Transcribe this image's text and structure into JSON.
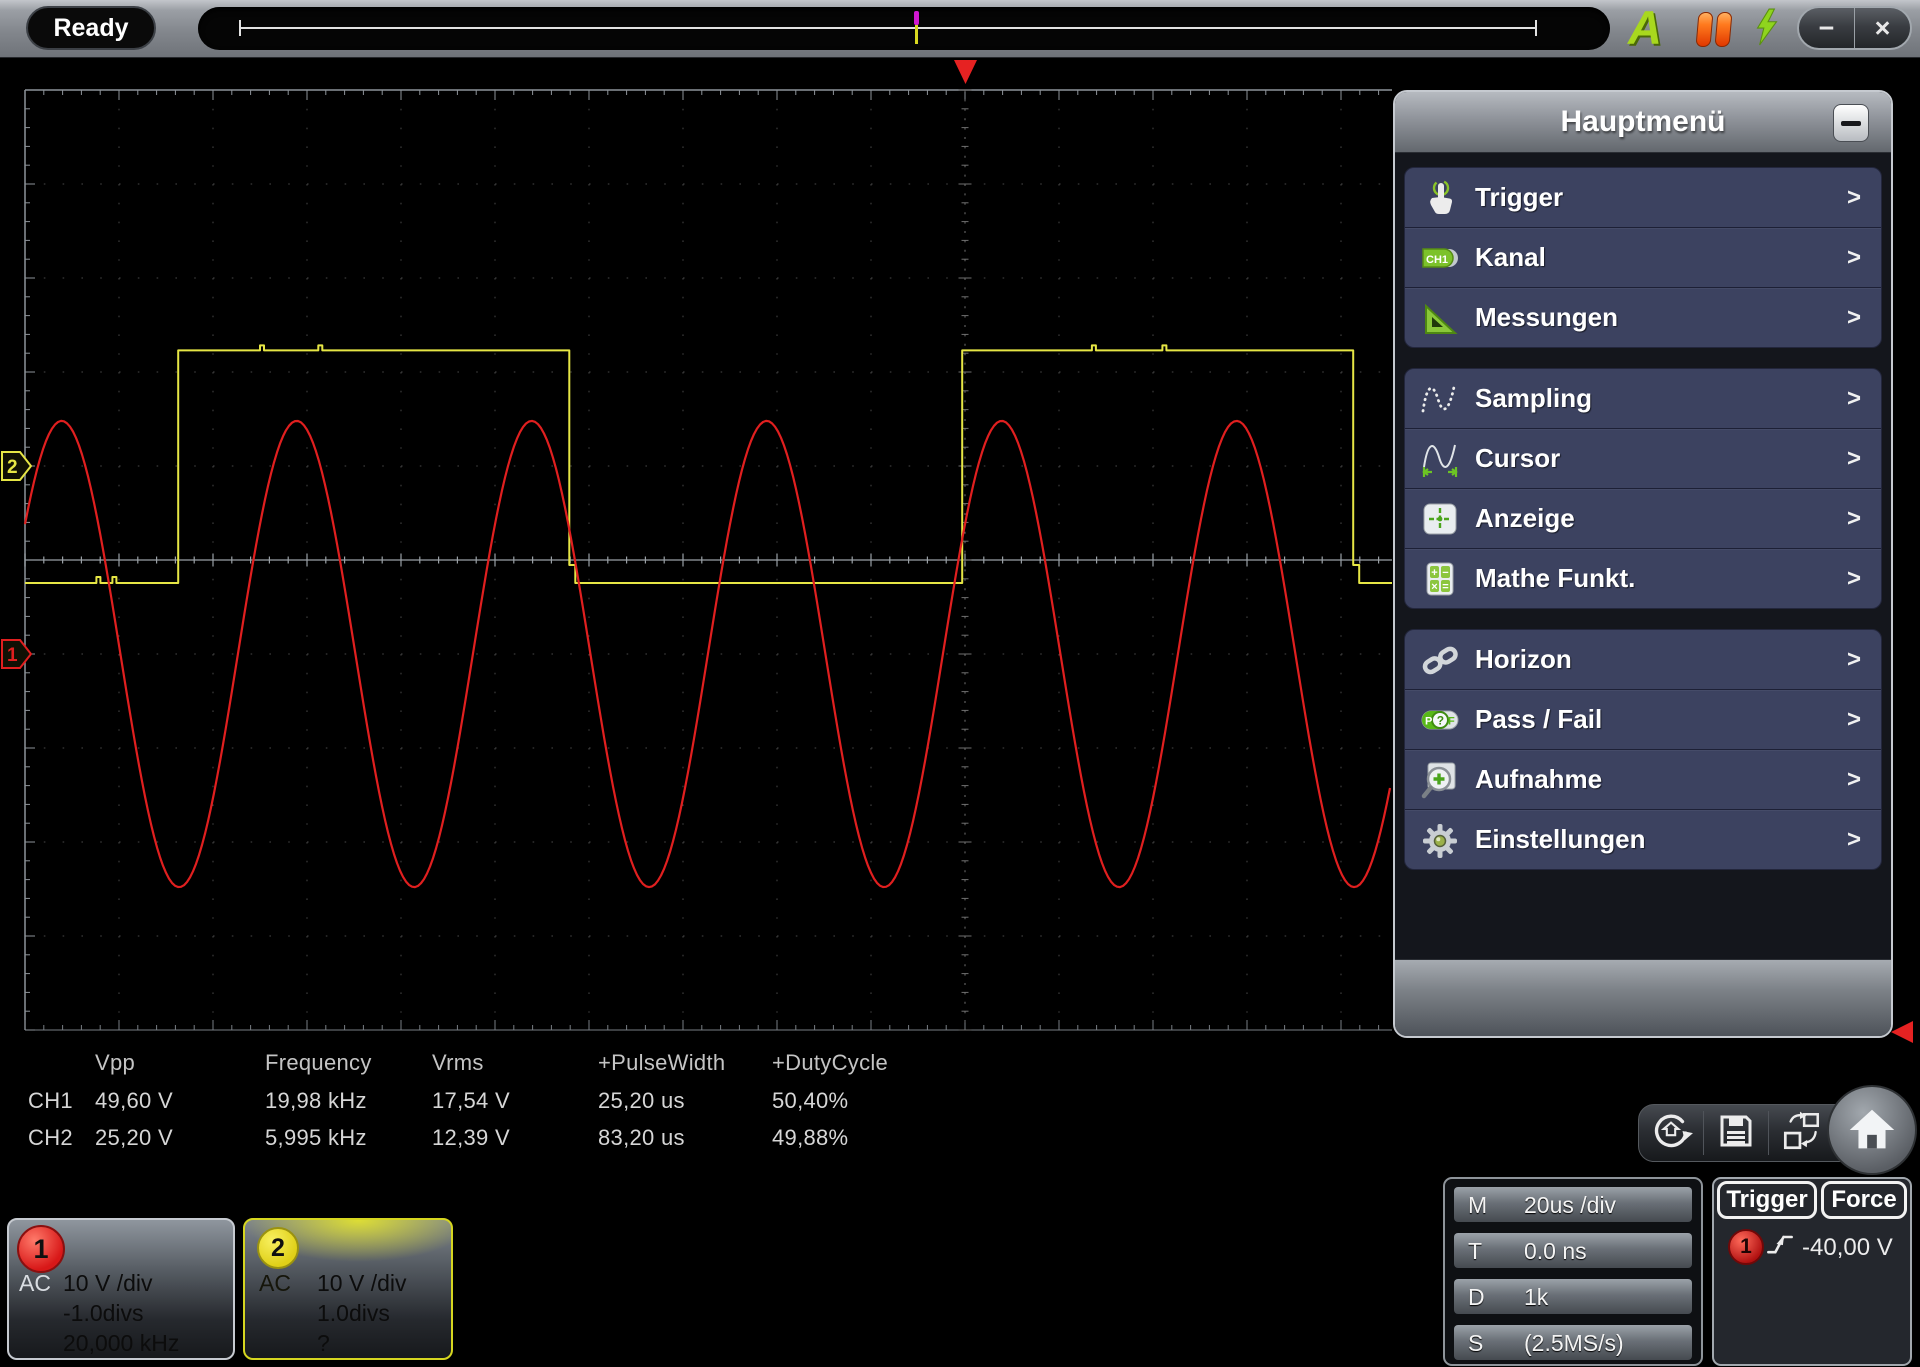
{
  "titlebar": {
    "status": "Ready",
    "auto_label": "A",
    "minimize_label": "−",
    "close_label": "×"
  },
  "menu": {
    "title": "Hauptmenü",
    "minimize_glyph": "−",
    "chevron": ">",
    "groups": [
      {
        "items": [
          {
            "label": "Trigger",
            "icon": "trigger-hand-icon"
          },
          {
            "label": "Kanal",
            "icon": "channel-tag-icon"
          },
          {
            "label": "Messungen",
            "icon": "measure-triangle-icon"
          }
        ]
      },
      {
        "items": [
          {
            "label": "Sampling",
            "icon": "sampling-sine-icon"
          },
          {
            "label": "Cursor",
            "icon": "cursor-sine-icon"
          },
          {
            "label": "Anzeige",
            "icon": "display-crosshair-icon"
          },
          {
            "label": "Mathe Funkt.",
            "icon": "math-calculator-icon"
          }
        ]
      },
      {
        "items": [
          {
            "label": "Horizon",
            "icon": "chain-link-icon"
          },
          {
            "label": "Pass / Fail",
            "icon": "pass-fail-icon"
          },
          {
            "label": "Aufnahme",
            "icon": "record-magnifier-icon"
          },
          {
            "label": "Einstellungen",
            "icon": "gear-icon"
          }
        ]
      }
    ]
  },
  "measurements": {
    "headers": [
      "Vpp",
      "Frequency",
      "Vrms",
      "+PulseWidth",
      "+DutyCycle"
    ],
    "rows": [
      {
        "channel": "CH1",
        "values": [
          "49,60 V",
          "19,98 kHz",
          "17,54 V",
          "25,20 us",
          "50,40%"
        ]
      },
      {
        "channel": "CH2",
        "values": [
          "25,20 V",
          "5,995 kHz",
          "12,39 V",
          "83,20 us",
          "49,88%"
        ]
      }
    ]
  },
  "channel_boxes": [
    {
      "number": "1",
      "coupling": "AC",
      "scale": "10 V /div",
      "position": "-1.0divs",
      "frequency": "20,000 kHz",
      "accent": "#d81818"
    },
    {
      "number": "2",
      "coupling": "AC",
      "scale": "10 V /div",
      "position": "1.0divs",
      "frequency": "?",
      "accent": "#e0d018"
    }
  ],
  "horizontal_panel": {
    "rows": [
      {
        "label": "M",
        "value": "20us /div"
      },
      {
        "label": "T",
        "value": "0.0 ns"
      },
      {
        "label": "D",
        "value": "1k"
      },
      {
        "label": "S",
        "value": "(2.5MS/s)"
      }
    ]
  },
  "trigger_panel": {
    "trigger_button": "Trigger",
    "force_button": "Force",
    "source_channel": "1",
    "level": "-40,00 V"
  },
  "toolbar_icons": [
    "reset-default-icon",
    "save-icon",
    "swap-window-icon"
  ],
  "chart_data": {
    "type": "line",
    "title": "Oscilloscope display: CH1 sine, CH2 square",
    "x_axis": {
      "divs": 20,
      "time_per_div": "20us",
      "trigger_position_div": 10
    },
    "y_axis": {
      "divs": 10
    },
    "series": [
      {
        "name": "CH1",
        "shape": "sine",
        "color": "#e01f1f",
        "volts_per_div": "10 V",
        "amplitude_div": 2.48,
        "center_offset_div": -1.0,
        "period_div": 2.5,
        "first_peak_div": 2.89,
        "frequency": "19,98 kHz",
        "marker": "1",
        "marker_position_div": -1.0
      },
      {
        "name": "CH2",
        "shape": "square",
        "color": "#e6e645",
        "volts_per_div": "10 V",
        "high_level_div": 2.23,
        "low_level_div": -0.245,
        "rising_edges_div": [
          1.63,
          9.97
        ],
        "falling_edges_div": [
          5.79,
          14.13
        ],
        "frequency": "5,995 kHz",
        "marker": "2",
        "marker_position_div": 1.0,
        "glitches_low_div": [
          0.76,
          0.93
        ],
        "glitches_high_div": [
          2.5,
          3.12,
          11.35,
          12.1
        ]
      }
    ],
    "trigger": {
      "level": "-40,00 V",
      "slope": "rising",
      "source": "CH1"
    }
  }
}
